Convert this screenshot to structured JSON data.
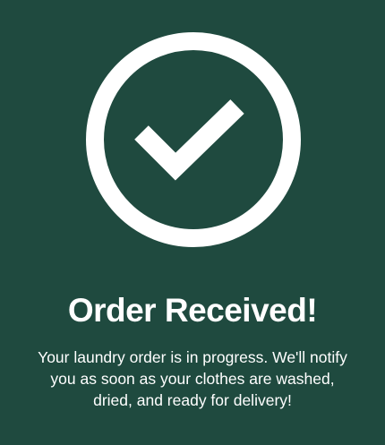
{
  "confirmation": {
    "icon": "checkmark-circle-icon",
    "title": "Order Received!",
    "message": "Your laundry order is in progress. We'll notify you as soon as your clothes are washed, dried, and ready for delivery!"
  },
  "colors": {
    "background": "#1f4a3f",
    "foreground": "#ffffff"
  }
}
